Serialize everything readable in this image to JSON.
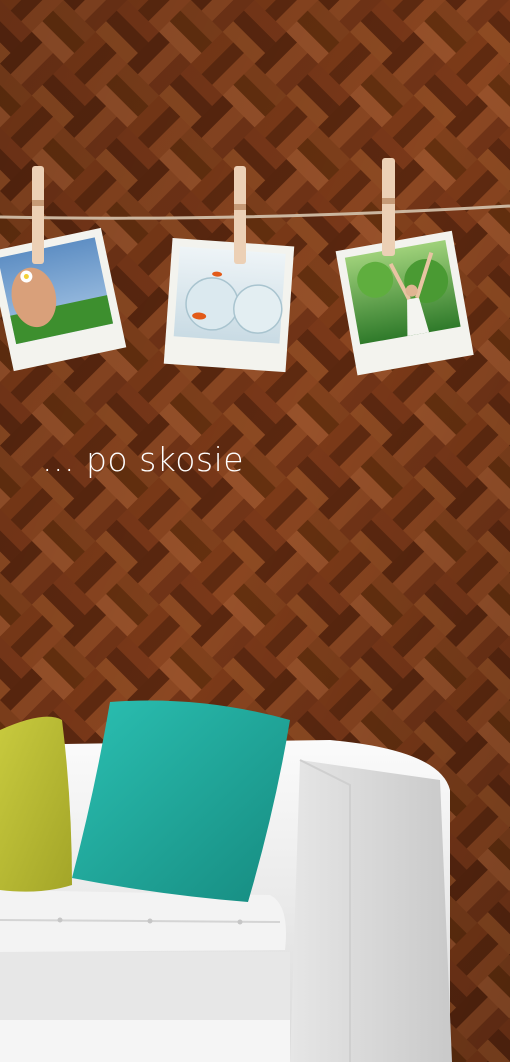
{
  "tagline": "... po skosie",
  "palette": {
    "wood_dark": "#4e220c",
    "wood_mid": "#7a3a18",
    "wood_light": "#a85a2a",
    "clothespin": "#eecfb2",
    "string": "#c9b29a",
    "pillow_yellow": "#bdbf35",
    "pillow_teal": "#1fa89c",
    "sofa_white": "#f1f1f1"
  },
  "photos": [
    {
      "subject": "feet-on-grass-photo"
    },
    {
      "subject": "goldfish-bowls-photo"
    },
    {
      "subject": "person-in-forest-photo"
    }
  ]
}
